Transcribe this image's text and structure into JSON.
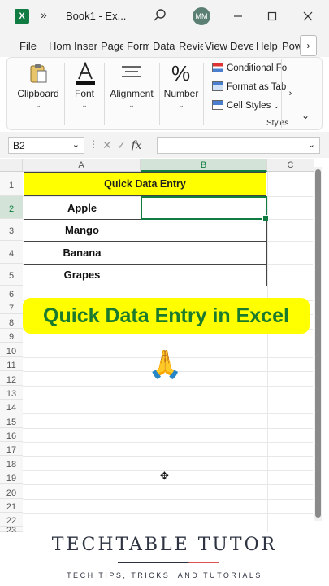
{
  "titlebar": {
    "app_icon": "excel-logo-icon",
    "app_letter": "X",
    "more": "»",
    "title": "Book1 - Ex...",
    "avatar_initials": "MM"
  },
  "tabs": [
    {
      "label": "File"
    },
    {
      "label": "Hom"
    },
    {
      "label": "Inser"
    },
    {
      "label": "Page"
    },
    {
      "label": "Form"
    },
    {
      "label": "Data"
    },
    {
      "label": "Revie"
    },
    {
      "label": "View"
    },
    {
      "label": "Deve"
    },
    {
      "label": "Help"
    },
    {
      "label": "Pow"
    }
  ],
  "tab_scroll": "›",
  "ribbon": {
    "clipboard": "Clipboard",
    "font": "Font",
    "alignment": "Alignment",
    "number": "Number",
    "conditional": "Conditional Fo",
    "format_as_table": "Format as Tab",
    "cell_styles": "Cell Styles",
    "styles": "Styles",
    "chevron": "⌄",
    "more": "›",
    "collapse": "⌄"
  },
  "formula_bar": {
    "name_box": "B2",
    "fx": "fx",
    "cancel": "✕",
    "confirm": "✓",
    "formula": ""
  },
  "columns": [
    "A",
    "B",
    "C"
  ],
  "rows": [
    "1",
    "2",
    "3",
    "4",
    "5",
    "6",
    "7",
    "8",
    "9",
    "10",
    "11",
    "12",
    "13",
    "14",
    "15",
    "16",
    "17",
    "18",
    "19",
    "20",
    "21",
    "22",
    "23"
  ],
  "sheet": {
    "title": "Quick Data Entry",
    "items": [
      "Apple",
      "Mango",
      "Banana",
      "Grapes"
    ]
  },
  "banner": "Quick Data Entry in Excel",
  "emoji": "🙏",
  "footer": {
    "brand": "TECHTABLE TUTOR",
    "tagline": "TECH TIPS, TRICKS, AND TUTORIALS"
  },
  "colors": {
    "accent": "#107c41",
    "highlight": "#ffff00",
    "banner_text": "#1a7a2e"
  }
}
